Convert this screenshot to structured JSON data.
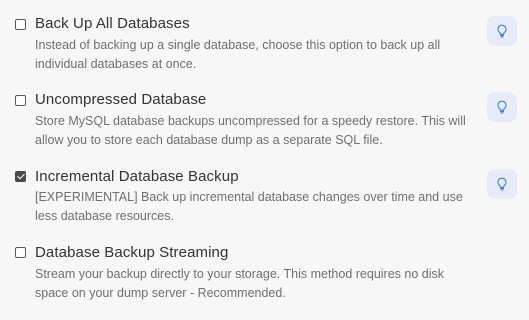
{
  "options": [
    {
      "title": "Back Up All Databases",
      "description": "Instead of backing up a single database, choose this option to back up all individual databases at once.",
      "checked": false,
      "tip_icon": "lightbulb-icon"
    },
    {
      "title": "Uncompressed Database",
      "description": "Store MySQL database backups uncompressed for a speedy restore. This will allow you to store each database dump as a separate SQL file.",
      "checked": false,
      "tip_icon": "lightbulb-icon"
    },
    {
      "title": "Incremental Database Backup",
      "description": "[EXPERIMENTAL] Back up incremental database changes over time and use less database resources.",
      "checked": true,
      "tip_icon": "lightbulb-icon"
    },
    {
      "title": "Database Backup Streaming",
      "description": "Stream your backup directly to your storage. This method requires no disk space on your dump server - Recommended.",
      "checked": false
    }
  ],
  "colors": {
    "background": "#f7f7f8",
    "tip_background": "#e6ebf7",
    "tip_icon": "#4a7cc9",
    "checkbox_checked": "#4a4a4a"
  }
}
